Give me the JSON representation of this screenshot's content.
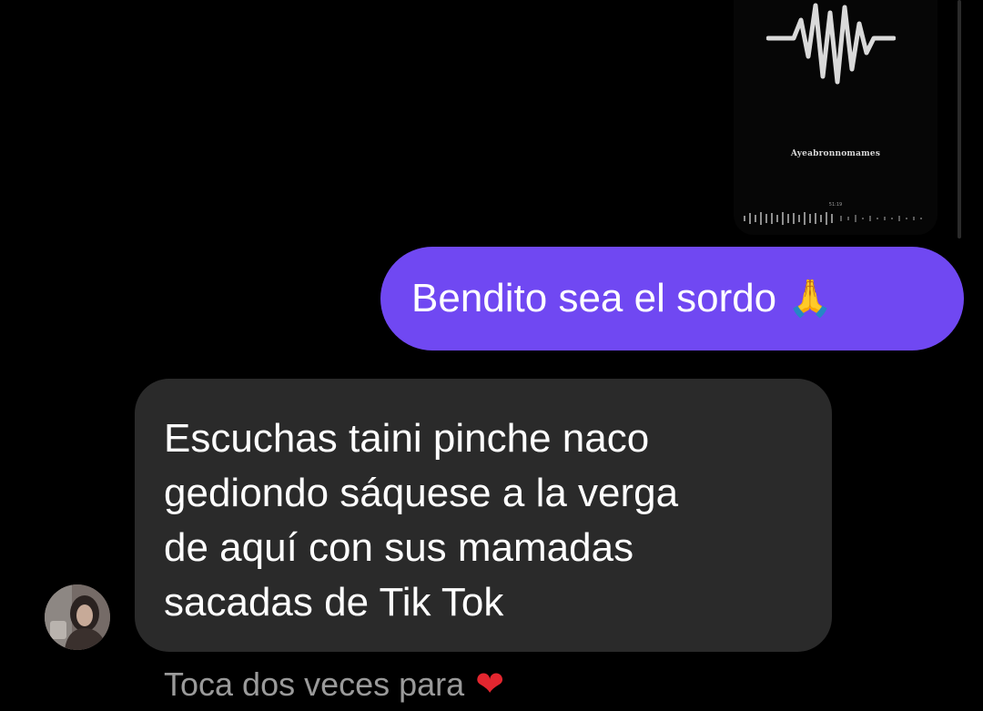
{
  "shared_reel": {
    "title": "Ayeabronnomames",
    "timestamp": "51:19",
    "icon": "audio-waveform-icon"
  },
  "messages": [
    {
      "direction": "sent",
      "text": "Bendito sea el sordo",
      "emoji": "🙏",
      "bubble_color": "#7048f2"
    },
    {
      "direction": "received",
      "text": "Escuchas taini pinche naco\ngediondo sáquese a la verga\nde aquí con sus mamadas\nsacadas de Tik Tok",
      "bubble_color": "#2a2a2a",
      "sender_avatar": "avatar"
    }
  ],
  "reaction_hint": {
    "text": "Toca dos veces para",
    "emoji": "❤️"
  },
  "colors": {
    "background": "#000000",
    "accent": "#7048f2",
    "hint_text": "#9a9a9a",
    "heart": "#e3262f"
  }
}
